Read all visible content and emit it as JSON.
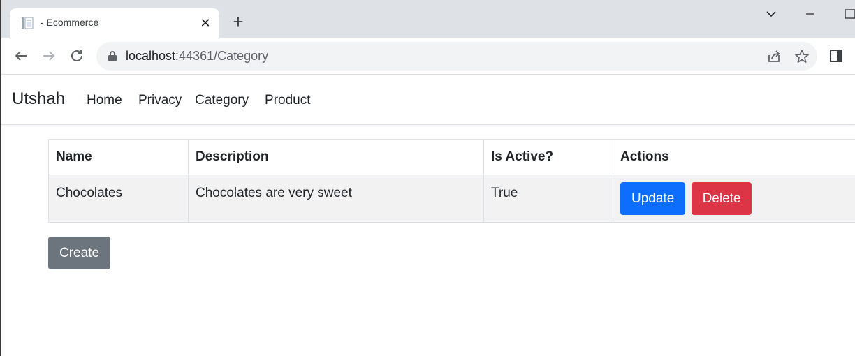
{
  "browser": {
    "tab": {
      "title": "- Ecommerce",
      "close_glyph": "✕"
    },
    "new_tab_glyph": "+",
    "url": {
      "host": "localhost:",
      "path": "44361/Category"
    }
  },
  "navbar": {
    "brand": "Utshah",
    "links": [
      "Home",
      "Privacy",
      "Category",
      "Product"
    ]
  },
  "table": {
    "headers": [
      "Name",
      "Description",
      "Is Active?",
      "Actions"
    ],
    "rows": [
      {
        "name": "Chocolates",
        "description": "Chocolates are very sweet",
        "is_active": "True"
      }
    ],
    "update_label": "Update",
    "delete_label": "Delete"
  },
  "create_label": "Create",
  "colors": {
    "primary": "#0d6efd",
    "danger": "#dc3545",
    "secondary": "#6c757d",
    "tabstrip": "#dee1e6"
  }
}
